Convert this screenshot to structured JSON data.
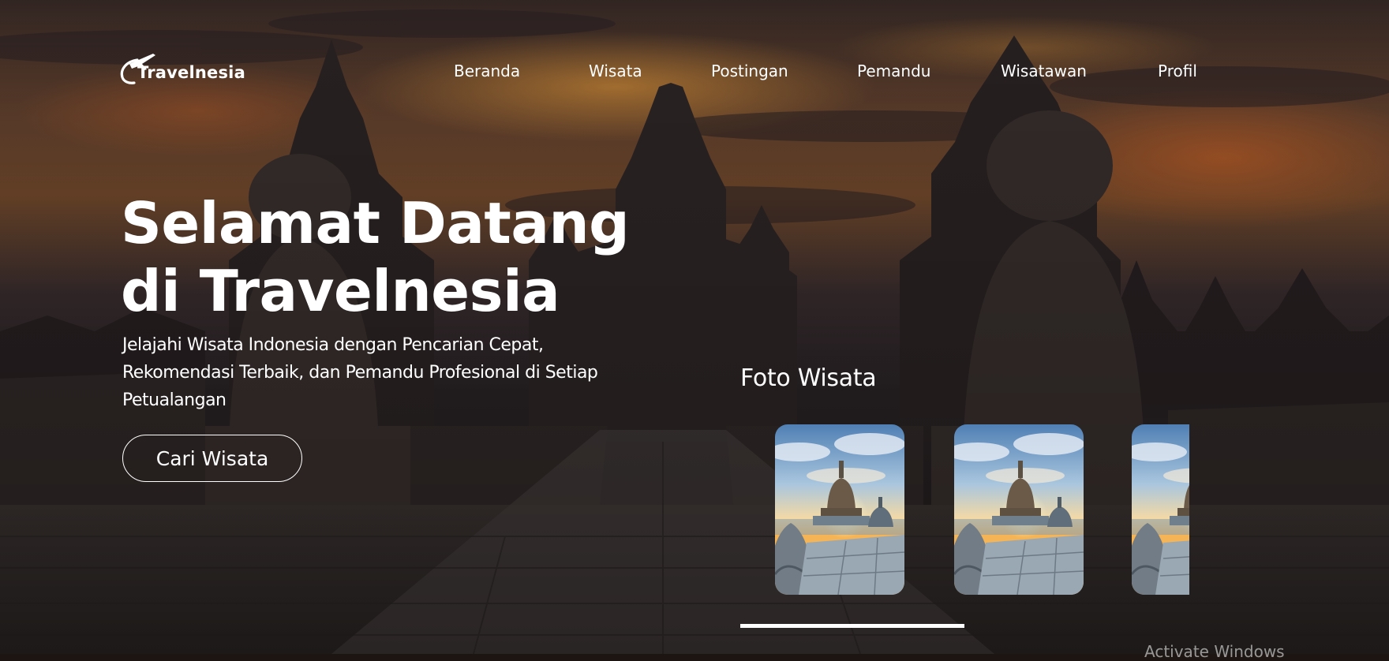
{
  "brand": {
    "logo_text": "Travelnesia",
    "logo_icon": "airplane-swoosh-icon"
  },
  "nav": {
    "items": [
      {
        "label": "Beranda"
      },
      {
        "label": "Wisata"
      },
      {
        "label": "Postingan"
      },
      {
        "label": "Pemandu"
      },
      {
        "label": "Wisatawan"
      },
      {
        "label": "Profil"
      }
    ]
  },
  "hero": {
    "title_line1": "Selamat Datang",
    "title_line2": "di Travelnesia",
    "subtitle_line1": "Jelajahi Wisata Indonesia dengan Pencarian Cepat,",
    "subtitle_line2": "Rekomendasi Terbaik, dan Pemandu Profesional di Setiap",
    "subtitle_line3": "Petualangan",
    "cta_label": "Cari Wisata"
  },
  "gallery": {
    "title": "Foto Wisata",
    "photos": [
      {
        "subject": "borobudur-stupa-sunrise"
      },
      {
        "subject": "borobudur-stupa-sunrise"
      },
      {
        "subject": "borobudur-stupa-sunrise"
      }
    ]
  },
  "os_overlay": {
    "watermark": "Activate Windows"
  },
  "colors": {
    "text": "#ffffff",
    "sky_orange": "#d9772b",
    "sky_dark": "#2a2226"
  }
}
